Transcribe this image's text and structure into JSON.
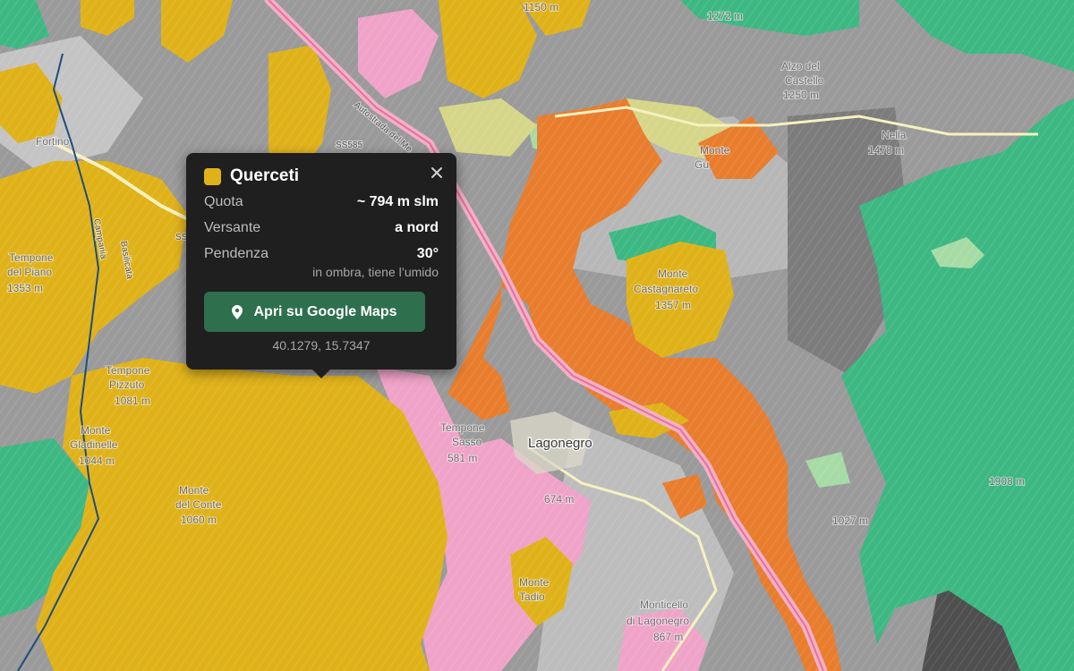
{
  "colors": {
    "oak": "#e0b21a",
    "chestnut": "#e87d2e",
    "beech": "#3db883",
    "meadow": "#a7dba5",
    "pink": "#f0a3c8",
    "rock": "#8d8d8d",
    "button": "#2e6f4e"
  },
  "map_labels": {
    "summit_top": "1150 m",
    "summit_top_right": "1272 m",
    "alzo_name": "Alzo del",
    "alzo_name2": "Castello",
    "alzo_elev": "1250 m",
    "monte_gu": "Monte",
    "monte_gu2": "Gu",
    "nella": "Nella",
    "nella_elev": "1478 m",
    "fortino": "Fortino",
    "tempone_piano": "Tempone",
    "tempone_piano2": "del Piano",
    "tempone_piano_elev": "1353 m",
    "tempone_pizzuto": "Tempone",
    "tempone_pizzuto2": "Pizzuto",
    "tempone_pizzuto_elev": "1081 m",
    "monte_gladinelle": "Monte",
    "monte_gladinelle2": "Gladinelle",
    "monte_gladinelle_elev": "1044 m",
    "monte_conte": "Monte",
    "monte_conte2": "del Conte",
    "monte_conte_elev": "1060 m",
    "monte_castagnareto": "Monte",
    "monte_castagnareto2": "Castagnareto",
    "monte_castagnareto_elev": "1357 m",
    "tempone_sasso": "Tempone",
    "tempone_sasso2": "Sasso",
    "tempone_sasso_elev": "581 m",
    "lagonegro": "Lagonegro",
    "elev_674": "674 m",
    "elev_1027": "1027 m",
    "elev_1908": "1908 m",
    "monte_tadio": "Monte",
    "monte_tadio2": "Tadio",
    "monticello": "Monticello",
    "monticello2": "di Lagonegro",
    "monticello_elev": "867 m",
    "road_highway": "Autostrada del Me",
    "road_ss585": "SS585",
    "road_campania": "Campania",
    "road_basilicata": "Basilicata",
    "road_sp": "SS"
  },
  "popup": {
    "title": "Querceti",
    "rows": [
      {
        "key": "Quota",
        "value": "~ 794 m slm"
      },
      {
        "key": "Versante",
        "value": "a nord"
      },
      {
        "key": "Pendenza",
        "value": "30°"
      }
    ],
    "note": "in ombra, tiene l’umido",
    "button_label": "Apri su Google Maps",
    "coordinates": "40.1279, 15.7347",
    "icons": {
      "close": "close-icon",
      "pin": "map-pin-icon"
    }
  }
}
